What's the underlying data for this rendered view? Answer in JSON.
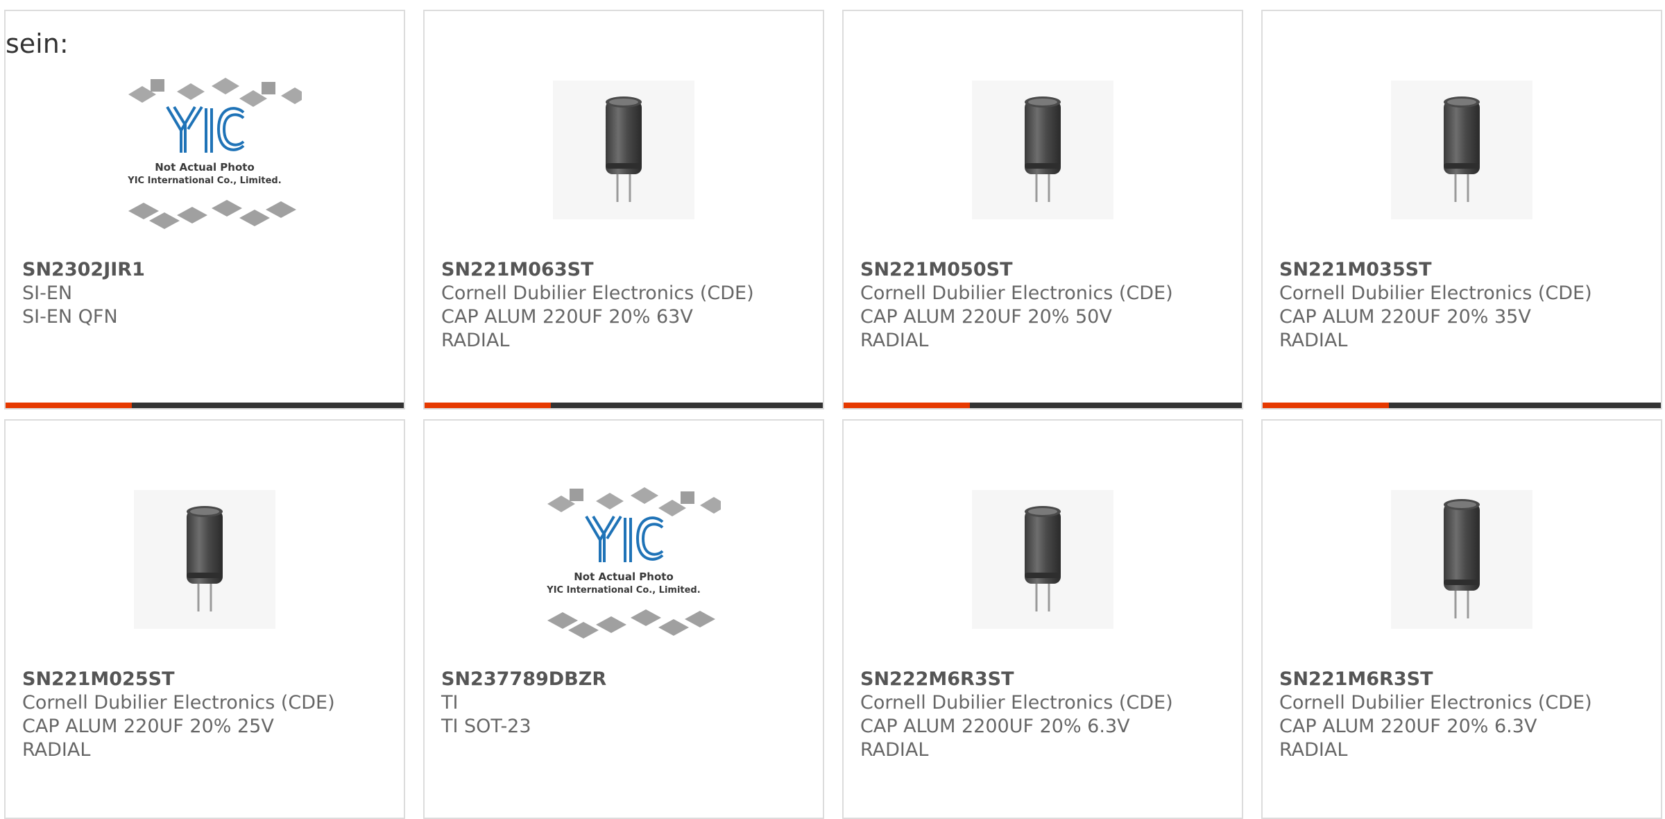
{
  "heading": "sein:",
  "colors": {
    "accent": "#e63900",
    "bar": "#333333",
    "border": "#dcdcdc",
    "text": "#666666"
  },
  "products": [
    {
      "part_number": "SN2302JIR1",
      "manufacturer": "SI-EN",
      "description": "SI-EN QFN",
      "description2": "",
      "image": "not-actual-photo-placeholder",
      "logo_text": "YIC",
      "caption1": "Not Actual Photo",
      "caption2": "YIC International Co., Limited."
    },
    {
      "part_number": "SN221M063ST",
      "manufacturer": "Cornell Dubilier Electronics (CDE)",
      "description": "CAP ALUM 220UF 20% 63V",
      "description2": "RADIAL",
      "image": "electrolytic-capacitor"
    },
    {
      "part_number": "SN221M050ST",
      "manufacturer": "Cornell Dubilier Electronics (CDE)",
      "description": "CAP ALUM 220UF 20% 50V",
      "description2": "RADIAL",
      "image": "electrolytic-capacitor"
    },
    {
      "part_number": "SN221M035ST",
      "manufacturer": "Cornell Dubilier Electronics (CDE)",
      "description": "CAP ALUM 220UF 20% 35V",
      "description2": "RADIAL",
      "image": "electrolytic-capacitor"
    },
    {
      "part_number": "SN221M025ST",
      "manufacturer": "Cornell Dubilier Electronics (CDE)",
      "description": "CAP ALUM 220UF 20% 25V",
      "description2": "RADIAL",
      "image": "electrolytic-capacitor"
    },
    {
      "part_number": "SN237789DBZR",
      "manufacturer": "TI",
      "description": "TI SOT-23",
      "description2": "",
      "image": "not-actual-photo-placeholder",
      "logo_text": "YIC",
      "caption1": "Not Actual Photo",
      "caption2": "YIC International Co., Limited."
    },
    {
      "part_number": "SN222M6R3ST",
      "manufacturer": "Cornell Dubilier Electronics (CDE)",
      "description": "CAP ALUM 2200UF 20% 6.3V",
      "description2": "RADIAL",
      "image": "electrolytic-capacitor"
    },
    {
      "part_number": "SN221M6R3ST",
      "manufacturer": "Cornell Dubilier Electronics (CDE)",
      "description": "CAP ALUM 220UF 20% 6.3V",
      "description2": "RADIAL",
      "image": "electrolytic-capacitor"
    }
  ]
}
